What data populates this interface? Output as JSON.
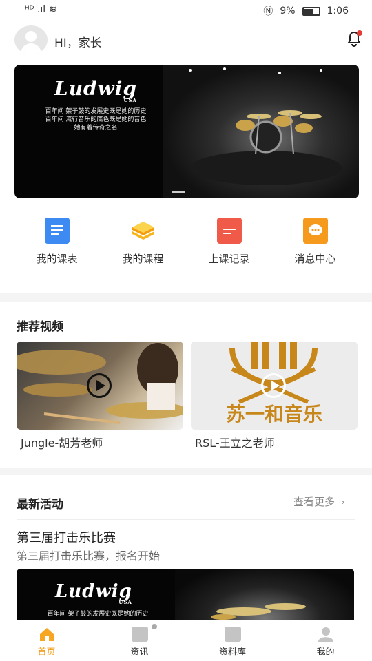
{
  "status_bar": {
    "left": "ᴴᴰ .ıl ≋",
    "battery": "9%",
    "time": "1:06"
  },
  "header": {
    "greeting": "HI，家长"
  },
  "banner": {
    "logo": "Ludwig",
    "logo_sub": "USA",
    "tagline_1": "百年间 架子鼓的发展史既是她的历史",
    "tagline_2": "百年间 流行音乐的底色既是她的音色",
    "tagline_3": "她有着传奇之名"
  },
  "quick_menu": [
    {
      "label": "我的课表",
      "icon": "schedule-icon",
      "color": "#3d8bf2"
    },
    {
      "label": "我的课程",
      "icon": "course-layers-icon",
      "color": "#f7b51b"
    },
    {
      "label": "上课记录",
      "icon": "record-doc-icon",
      "color": "#f05a48"
    },
    {
      "label": "消息中心",
      "icon": "message-chat-icon",
      "color": "#f59a1d"
    }
  ],
  "videos": {
    "title": "推荐视频",
    "items": [
      {
        "label": "Jungle-胡芳老师"
      },
      {
        "label": "RSL-王立之老师",
        "brand_text": "苏一和音乐"
      }
    ]
  },
  "activities": {
    "title": "最新活动",
    "more": "查看更多",
    "item": {
      "title": "第三届打击乐比赛",
      "subtitle": "第三届打击乐比赛，报名开始",
      "logo": "Ludwig",
      "logo_sub": "USA",
      "tagline": "百年间 架子鼓的发展史既是她的历史"
    }
  },
  "tabbar": [
    {
      "label": "首页",
      "icon": "home-icon",
      "active": true
    },
    {
      "label": "资讯",
      "icon": "news-icon",
      "active": false
    },
    {
      "label": "资料库",
      "icon": "library-icon",
      "active": false
    },
    {
      "label": "我的",
      "icon": "profile-icon",
      "active": false
    }
  ],
  "colors": {
    "accent": "#f29b13",
    "badge": "#e53935"
  }
}
